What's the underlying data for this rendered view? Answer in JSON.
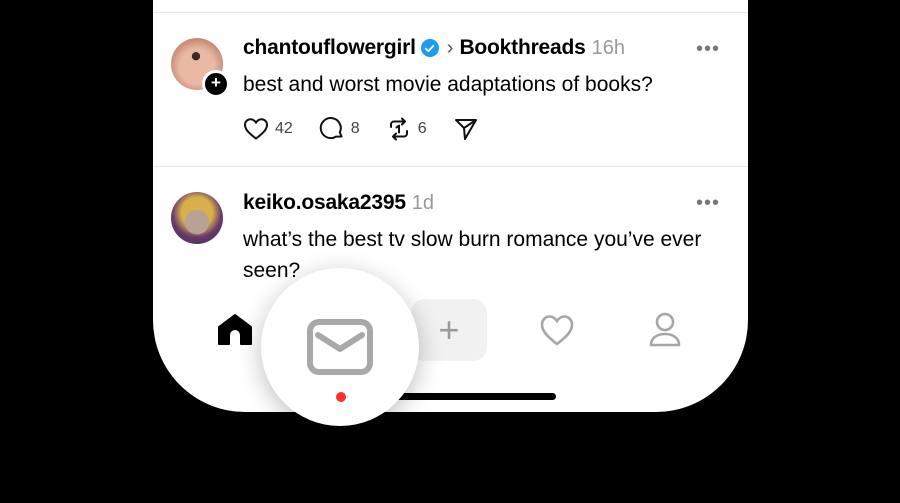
{
  "posts": [
    {
      "username": "chantouflowergirl",
      "verified": true,
      "community": "Bookthreads",
      "time": "16h",
      "more": "•••",
      "text": "best and worst movie adaptations of books?",
      "likes": "42",
      "replies": "8",
      "reposts": "6",
      "follow_badge": "+"
    },
    {
      "username": "keiko.osaka2395",
      "time": "1d",
      "more": "•••",
      "text": "what’s the best tv slow burn romance you’ve ever seen?"
    }
  ],
  "navbar": {
    "items": [
      "home-icon",
      "search-icon",
      "compose-icon",
      "activity-heart-icon",
      "profile-icon"
    ],
    "compose_label": "+"
  },
  "magnifier": {
    "icon": "mail-icon",
    "badge_color": "#ff2d2d"
  },
  "colors": {
    "verified": "#1d9bf0",
    "muted": "#999999",
    "background": "#000000"
  }
}
